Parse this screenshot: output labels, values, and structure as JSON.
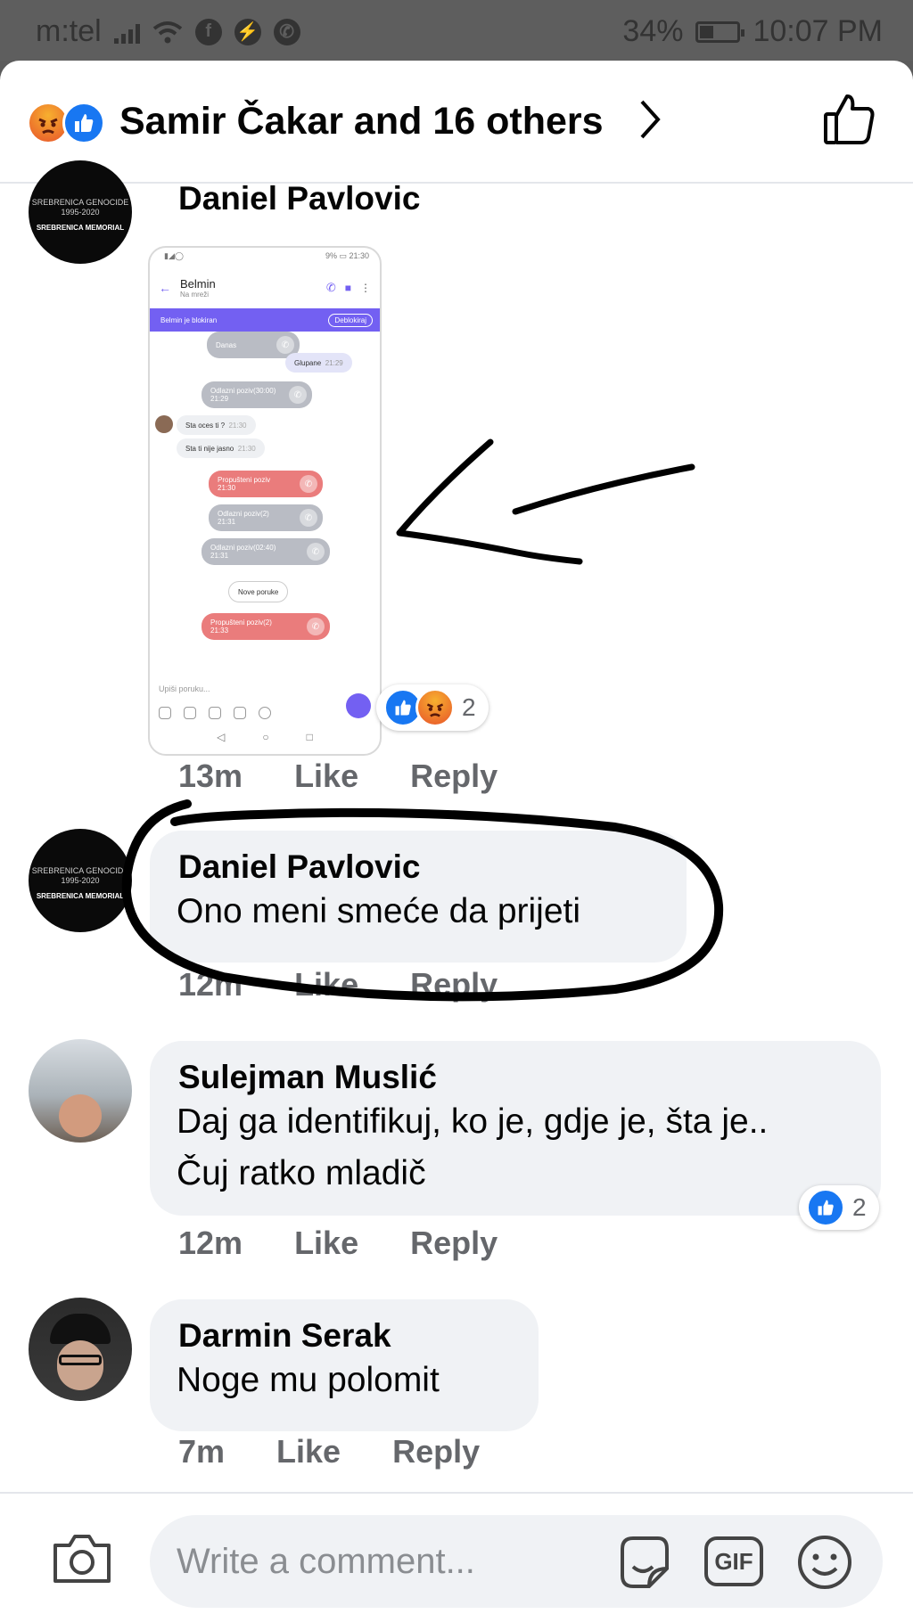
{
  "status_bar": {
    "carrier": "m:tel",
    "battery": "34%",
    "battery_level": 0.34,
    "time": "10:07 PM",
    "app_icons": [
      "signal-icon",
      "wifi-icon",
      "facebook-icon",
      "messenger-icon",
      "whatsapp-icon"
    ]
  },
  "header": {
    "reactions": [
      "angry-reaction-icon",
      "like-reaction-icon"
    ],
    "title": "Samir Čakar and 16 others"
  },
  "comments": [
    {
      "author": "Daniel Pavlovic",
      "avatar_caption": "SREBRENICA GENOCIDE 1995-2020",
      "avatar_sub": "SREBRENICA MEMORIAL",
      "image": {
        "status_left": "▮◢◯",
        "status_right": "9% ▭ 21:30",
        "contact_name": "Belmin",
        "contact_sub": "Na mreži",
        "banner": "Belmin je blokiran",
        "banner_button": "Deblokiraj",
        "messages": [
          {
            "text": "Danas",
            "kind": "in"
          },
          {
            "text": "Glupane",
            "time": "21:29",
            "kind": "out"
          },
          {
            "text": "Odlazni poziv(30:00)",
            "time": "21:29",
            "kind": "call"
          },
          {
            "text": "Sta oces ti ?",
            "time": "21:30",
            "kind": "in"
          },
          {
            "text": "Sta ti nije jasno",
            "time": "21:30",
            "kind": "in"
          },
          {
            "text": "Propušteni poziv",
            "time": "21:30",
            "kind": "missed"
          },
          {
            "text": "Odlazni poziv(2)",
            "time": "21:31",
            "kind": "call"
          },
          {
            "text": "Odlazni poziv(02:40)",
            "time": "21:31",
            "kind": "call"
          },
          {
            "text": "Nove poruke",
            "kind": "in"
          },
          {
            "text": "Propušteni poziv(2)",
            "time": "21:33",
            "kind": "missed"
          }
        ],
        "input_placeholder": "Upiši poruku..."
      },
      "reaction_count": "2",
      "time": "13m",
      "like": "Like",
      "reply": "Reply"
    },
    {
      "author": "Daniel Pavlovic",
      "text": "Ono meni smeće da prijeti",
      "time": "12m",
      "like": "Like",
      "reply": "Reply"
    },
    {
      "author": "Sulejman Muslić",
      "text_line1": "Daj ga identifikuj, ko je, gdje je, šta je..",
      "text_line2": "Čuj ratko mladič",
      "reaction_count": "2",
      "time": "12m",
      "like": "Like",
      "reply": "Reply"
    },
    {
      "author": "Darmin Serak",
      "text": "Noge mu polomit",
      "time": "7m",
      "like": "Like",
      "reply": "Reply"
    }
  ],
  "composer": {
    "placeholder": "Write a comment...",
    "gif_label": "GIF"
  },
  "colors": {
    "like_blue": "#1877f2",
    "bubble_gray": "#f0f2f5",
    "meta_gray": "#65676b",
    "annotation_black": "#000000"
  }
}
